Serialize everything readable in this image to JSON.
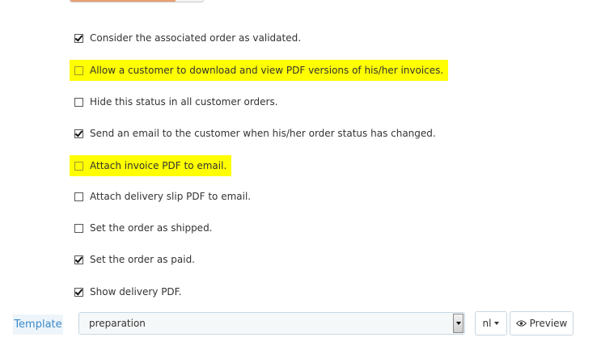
{
  "options": [
    {
      "label": "Consider the associated order as validated.",
      "checked": true,
      "highlighted": false
    },
    {
      "label": "Allow a customer to download and view PDF versions of his/her invoices.",
      "checked": false,
      "highlighted": true
    },
    {
      "label": "Hide this status in all customer orders.",
      "checked": false,
      "highlighted": false
    },
    {
      "label": "Send an email to the customer when his/her order status has changed.",
      "checked": true,
      "highlighted": false
    },
    {
      "label": "Attach invoice PDF to email.",
      "checked": false,
      "highlighted": true
    },
    {
      "label": "Attach delivery slip PDF to email.",
      "checked": false,
      "highlighted": false
    },
    {
      "label": "Set the order as shipped.",
      "checked": false,
      "highlighted": false
    },
    {
      "label": "Set the order as paid.",
      "checked": true,
      "highlighted": false
    },
    {
      "label": "Show delivery PDF.",
      "checked": true,
      "highlighted": false
    }
  ],
  "template": {
    "label": "Template",
    "selected": "preparation",
    "language": "nl",
    "preview_label": "Preview"
  },
  "colors": {
    "highlight": "#ffff00",
    "label_text": "#3a89c9",
    "label_bg": "#eef5fa"
  },
  "icons": {
    "check": "checkmark",
    "preview": "eye-icon",
    "language_dropdown": "caret-down-icon",
    "select_dropdown": "caret-down-icon"
  }
}
